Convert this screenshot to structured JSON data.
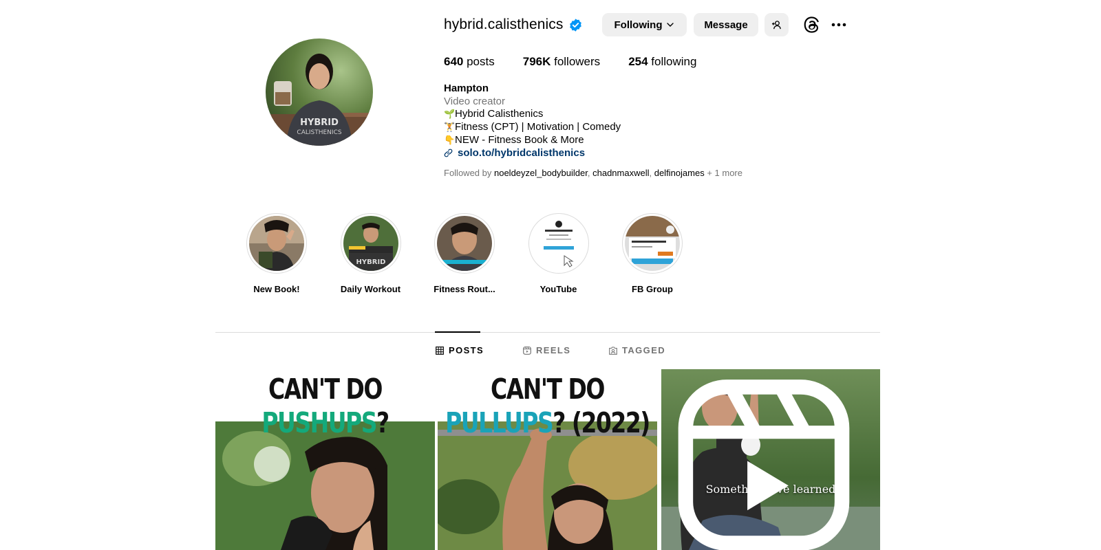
{
  "profile": {
    "username": "hybrid.calisthenics",
    "verified_color": "#0095f6",
    "buttons": {
      "following": "Following",
      "message": "Message"
    },
    "stats": {
      "posts_count": "640",
      "posts_label": " posts",
      "followers_count": "796K",
      "followers_label": " followers",
      "following_count": "254",
      "following_label": " following"
    },
    "bio": {
      "display_name": "Hampton",
      "category": "Video creator",
      "lines": [
        {
          "emoji": "🌱",
          "text": "Hybrid Calisthenics"
        },
        {
          "emoji": "🏋",
          "text": "Fitness (CPT) | Motivation | Comedy"
        },
        {
          "emoji": "👇",
          "text": "NEW - Fitness Book & More"
        }
      ],
      "link": "solo.to/hybridcalisthenics"
    },
    "followed_by": {
      "prefix": "Followed by ",
      "users": [
        "noeldeyzel_bodybuilder",
        "chadnmaxwell",
        "delfinojames"
      ],
      "sep": ", ",
      "suffix": " + 1 more"
    }
  },
  "highlights": [
    {
      "label": "New Book!"
    },
    {
      "label": "Daily Workout"
    },
    {
      "label": "Fitness Rout..."
    },
    {
      "label": "YouTube"
    },
    {
      "label": "FB Group"
    }
  ],
  "tabs": {
    "posts": "POSTS",
    "reels": "REELS",
    "tagged": "TAGGED"
  },
  "posts": [
    {
      "title_prefix": "CAN'T DO ",
      "title_accent": "PUSHUPS",
      "title_suffix": "?",
      "accent_color": "#14a97b"
    },
    {
      "title_prefix": "CAN'T DO ",
      "title_accent": "PULLUPS",
      "title_suffix": "? (2022)",
      "accent_color": "#1aa3b8"
    },
    {
      "caption": "Something I've learned",
      "type": "reel"
    }
  ],
  "icons": {
    "verified": "verified-badge-icon",
    "following_chevron": "chevron-down-icon",
    "suggest": "add-person-icon",
    "threads": "threads-icon",
    "more": "more-options-icon",
    "link": "link-icon",
    "posts_tab": "grid-icon",
    "reels_tab": "reels-icon",
    "tagged_tab": "tagged-icon",
    "reel_badge": "reel-icon"
  }
}
